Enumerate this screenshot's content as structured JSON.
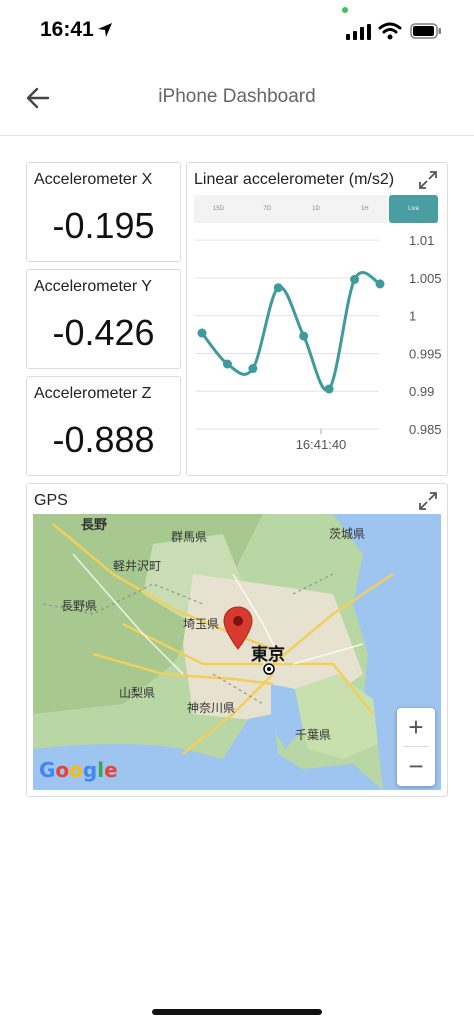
{
  "status": {
    "time": "16:41"
  },
  "header": {
    "title": "iPhone Dashboard"
  },
  "cards": {
    "accel_x": {
      "title": "Accelerometer X",
      "value": "-0.195"
    },
    "accel_y": {
      "title": "Accelerometer Y",
      "value": "-0.426"
    },
    "accel_z": {
      "title": "Accelerometer Z",
      "value": "-0.888"
    }
  },
  "chart_panel": {
    "title": "Linear accelerometer (m/s2)",
    "tabs": [
      "15D",
      "7D",
      "1D",
      "1H",
      "Live"
    ],
    "active_tab": "Live"
  },
  "chart_data": {
    "type": "line",
    "title": "Linear accelerometer (m/s2)",
    "x_tick_labels": [
      "16:41:40"
    ],
    "y_tick_labels": [
      "1.01",
      "1.005",
      "1",
      "0.995",
      "0.99",
      "0.985"
    ],
    "ylim": [
      0.985,
      1.012
    ],
    "series": [
      {
        "values": [
          0.9977,
          0.9936,
          0.993,
          1.0037,
          0.9973,
          0.9903,
          1.0048,
          1.0042
        ]
      }
    ],
    "color": "#3e9a9c",
    "grid": true
  },
  "gps": {
    "title": "GPS",
    "map_labels": [
      "長野",
      "群馬県",
      "茨城県",
      "軽井沢町",
      "長野県",
      "埼玉県",
      "東京",
      "山梨県",
      "神奈川県",
      "千葉県"
    ],
    "attribution": "Google",
    "zoom_in": "+",
    "zoom_out": "−"
  },
  "colors": {
    "accent": "#4a9ea1",
    "marker": "#d93a2f",
    "sea": "#9ec5f0"
  }
}
